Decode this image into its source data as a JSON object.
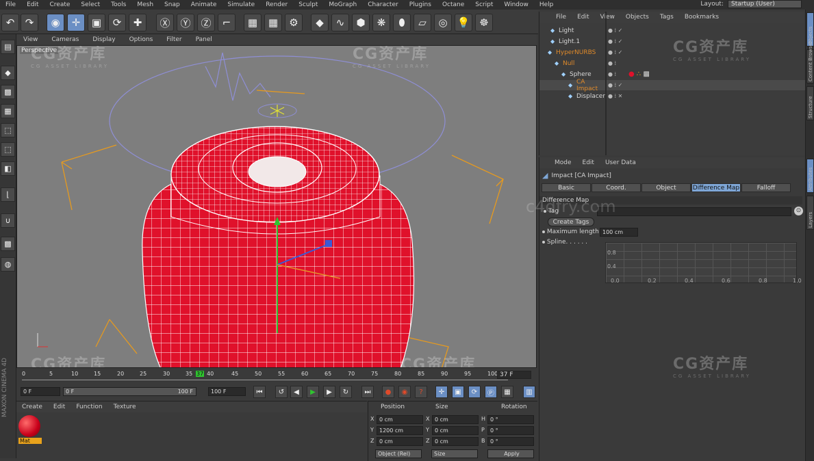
{
  "menubar": {
    "items": [
      "File",
      "Edit",
      "Create",
      "Select",
      "Tools",
      "Mesh",
      "Snap",
      "Animate",
      "Simulate",
      "Render",
      "Sculpt",
      "MoGraph",
      "Character",
      "Plugins",
      "Octane",
      "Script",
      "Window",
      "Help"
    ],
    "layout_label": "Layout:",
    "layout_value": "Startup (User)"
  },
  "viewport": {
    "menu": [
      "View",
      "Cameras",
      "Display",
      "Options",
      "Filter",
      "Panel"
    ],
    "label": "Perspective"
  },
  "watermark": {
    "text": "CG资产库",
    "sub": "CG ASSET LIBRARY",
    "site": "c4dfry.com"
  },
  "timeline": {
    "ticks": [
      "0",
      "5",
      "10",
      "15",
      "20",
      "25",
      "30",
      "35",
      "37",
      "40",
      "45",
      "50",
      "55",
      "60",
      "65",
      "70",
      "75",
      "80",
      "85",
      "90",
      "95",
      "100"
    ],
    "current_frame": "37 F"
  },
  "transport": {
    "start": "0 F",
    "range_start": "0 F",
    "range_end": "100 F",
    "end": "100 F"
  },
  "material": {
    "menu": [
      "Create",
      "Edit",
      "Function",
      "Texture"
    ],
    "name": "Mat"
  },
  "coords": {
    "headers": {
      "position": "Position",
      "size": "Size",
      "rotation": "Rotation"
    },
    "rows": [
      {
        "axis": "X",
        "pos": "0 cm",
        "size_axis": "X",
        "size": "0 cm",
        "rot_axis": "H",
        "rot": "0 °"
      },
      {
        "axis": "Y",
        "pos": "1200 cm",
        "size_axis": "Y",
        "size": "0 cm",
        "rot_axis": "P",
        "rot": "0 °"
      },
      {
        "axis": "Z",
        "pos": "0 cm",
        "size_axis": "Z",
        "size": "0 cm",
        "rot_axis": "B",
        "rot": "0 °"
      }
    ],
    "mode": "Object (Rel)",
    "size_mode": "Size",
    "apply": "Apply"
  },
  "objects": {
    "menu": [
      "File",
      "Edit",
      "View",
      "Objects",
      "Tags",
      "Bookmarks"
    ],
    "items": [
      {
        "name": "Light",
        "color": "#d8d8d8"
      },
      {
        "name": "Light.1",
        "color": "#d8d8d8"
      },
      {
        "name": "HyperNURBS",
        "color": "#e08a2a"
      },
      {
        "name": "Null",
        "color": "#e08a2a"
      },
      {
        "name": "Sphere",
        "color": "#d8d8d8"
      },
      {
        "name": "CA Impact",
        "color": "#e08a2a"
      },
      {
        "name": "Displacer",
        "color": "#d8d8d8"
      }
    ]
  },
  "attributes": {
    "menu": [
      "Mode",
      "Edit",
      "User Data"
    ],
    "title": "Impact [CA Impact]",
    "tabs": [
      "Basic",
      "Coord.",
      "Object",
      "Difference Map",
      "Falloff"
    ],
    "active_tab": "Difference Map",
    "section": "Difference Map",
    "tag_label": "Tag",
    "create_tags": "Create Tags",
    "max_length_label": "Maximum length",
    "max_length_value": "100 cm",
    "spline_label": "Spline. . . . . .",
    "graph_y": [
      "0.8",
      "0.4"
    ],
    "graph_x": [
      "0.0",
      "0.2",
      "0.4",
      "0.6",
      "0.8",
      "1.0"
    ]
  },
  "sidetabs": [
    "Objects",
    "Content Browser",
    "Structure",
    "Attributes",
    "Layers"
  ],
  "colors": {
    "accent": "#7ea6d6",
    "mesh": "#e0112b",
    "highlight": "#e08a2a"
  }
}
